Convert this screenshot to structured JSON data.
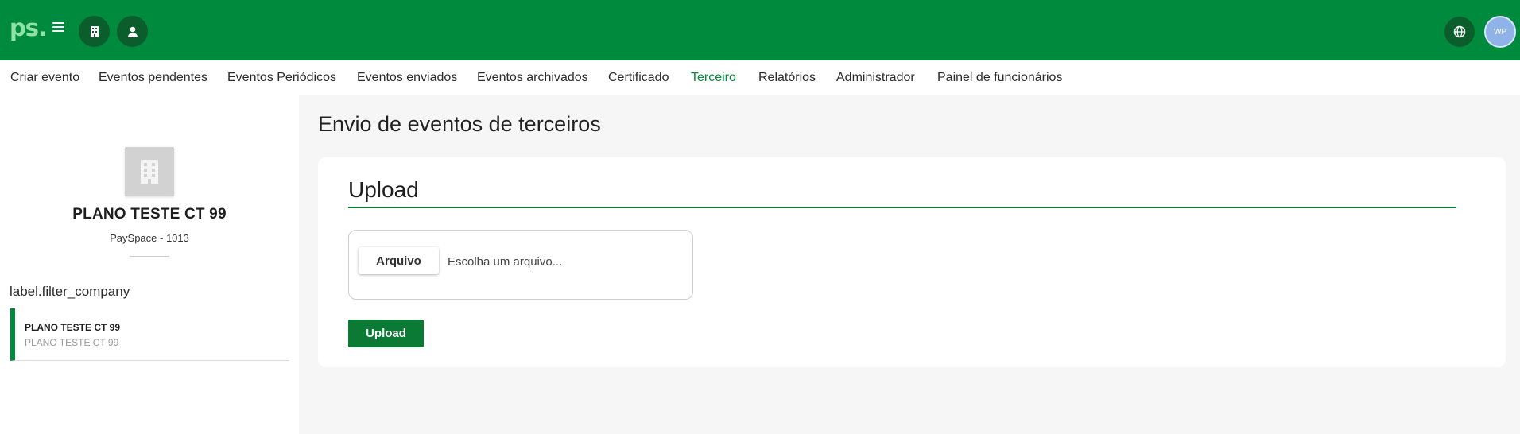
{
  "header": {
    "logo": "ps.",
    "avatar_initials": "WP",
    "icons": {
      "menu": "menu-icon",
      "company": "building-icon",
      "user": "user-icon",
      "language": "globe-icon"
    },
    "colors": {
      "brand": "#008a3d",
      "accent_dark": "#0b5e2c",
      "avatar": "#8fb3e8"
    }
  },
  "nav": {
    "items": [
      {
        "label": "Criar evento"
      },
      {
        "label": "Eventos pendentes"
      },
      {
        "label": "Eventos Periódicos"
      },
      {
        "label": "Eventos enviados"
      },
      {
        "label": "Eventos archivados"
      },
      {
        "label": "Certificado"
      },
      {
        "label": "Terceiro",
        "active": true
      },
      {
        "label": "Relatórios"
      },
      {
        "label": "Administrador"
      },
      {
        "label": "Painel de funcionários"
      }
    ]
  },
  "sidebar": {
    "company_name": "PLANO TESTE CT 99",
    "company_sub": "PaySpace - 1013",
    "filter_label": "label.filter_company",
    "companies": [
      {
        "title": "PLANO TESTE CT 99",
        "subtitle": "PLANO TESTE CT 99"
      }
    ]
  },
  "main": {
    "page_title": "Envio de eventos de terceiros",
    "section_title": "Upload",
    "file_button": "Arquivo",
    "file_placeholder": "Escolha um arquivo...",
    "upload_button": "Upload"
  }
}
